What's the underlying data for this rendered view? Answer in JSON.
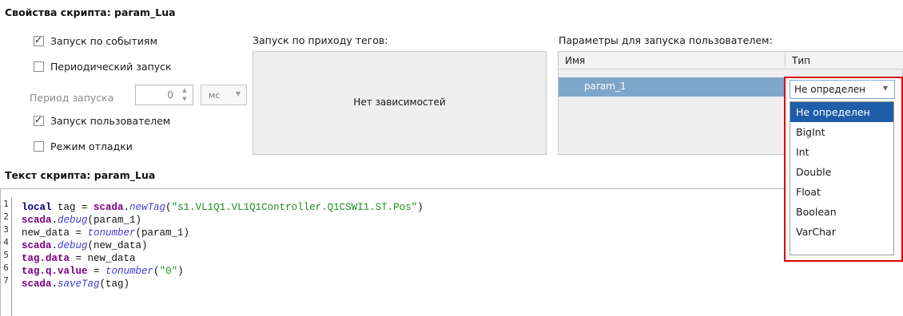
{
  "script_props_title": "Свойства скрипта: param_Lua",
  "options": {
    "event_launch": {
      "label": "Запуск по событиям",
      "checked": true
    },
    "periodic_launch": {
      "label": "Периодический запуск",
      "checked": false
    },
    "period_label": "Период запуска",
    "period_value": "0",
    "period_unit": "мс",
    "user_launch": {
      "label": "Запуск пользователем",
      "checked": true
    },
    "debug_mode": {
      "label": "Режим отладки",
      "checked": false
    }
  },
  "tags_trigger": {
    "label": "Запуск по приходу тегов:",
    "empty_text": "Нет зависимостей"
  },
  "user_params": {
    "label": "Параметры для запуска пользователем:",
    "columns": [
      "Имя",
      "Тип"
    ],
    "rows": [
      {
        "name": "param_1",
        "type": "Не определен"
      }
    ]
  },
  "type_dropdown": {
    "selected": "Не определен",
    "options": [
      "Не определен",
      "BigInt",
      "Int",
      "Double",
      "Float",
      "Boolean",
      "VarChar"
    ]
  },
  "script_text_title": "Текст скрипта: param_Lua",
  "code": {
    "line_numbers": [
      "1",
      "2",
      "3",
      "4",
      "5",
      "6",
      "7"
    ],
    "lines": [
      [
        {
          "t": "kw",
          "v": "local"
        },
        {
          "t": "plain",
          "v": " tag = "
        },
        {
          "t": "obj",
          "v": "scada"
        },
        {
          "t": "plain",
          "v": "."
        },
        {
          "t": "fn",
          "v": "newTag"
        },
        {
          "t": "plain",
          "v": "("
        },
        {
          "t": "str",
          "v": "\"s1.VL1Q1.VL1Q1Controller.Q1CSWI1.ST.Pos\""
        },
        {
          "t": "plain",
          "v": ")"
        }
      ],
      [
        {
          "t": "obj",
          "v": "scada"
        },
        {
          "t": "plain",
          "v": "."
        },
        {
          "t": "fn",
          "v": "debug"
        },
        {
          "t": "plain",
          "v": "(param_1)"
        }
      ],
      [
        {
          "t": "plain",
          "v": "new_data = "
        },
        {
          "t": "fn",
          "v": "tonumber"
        },
        {
          "t": "plain",
          "v": "(param_1)"
        }
      ],
      [
        {
          "t": "obj",
          "v": "scada"
        },
        {
          "t": "plain",
          "v": "."
        },
        {
          "t": "fn",
          "v": "debug"
        },
        {
          "t": "plain",
          "v": "(new_data)"
        }
      ],
      [
        {
          "t": "obj",
          "v": "tag.data"
        },
        {
          "t": "plain",
          "v": " = new_data"
        }
      ],
      [
        {
          "t": "obj",
          "v": "tag.q.value"
        },
        {
          "t": "plain",
          "v": " = "
        },
        {
          "t": "fn",
          "v": "tonumber"
        },
        {
          "t": "plain",
          "v": "("
        },
        {
          "t": "str",
          "v": "\"0\""
        },
        {
          "t": "plain",
          "v": ")"
        }
      ],
      [
        {
          "t": "obj",
          "v": "scada"
        },
        {
          "t": "plain",
          "v": "."
        },
        {
          "t": "fn",
          "v": "saveTag"
        },
        {
          "t": "plain",
          "v": "(tag)"
        }
      ]
    ]
  },
  "icons": {
    "check": "check-icon",
    "spin_arrows": "spin-arrows-icon",
    "combo_arrow": "chevron-down-icon"
  },
  "colors": {
    "highlight_border": "#e00000",
    "selected_row": "#7ea6c9",
    "selected_item": "#1f5da8"
  }
}
